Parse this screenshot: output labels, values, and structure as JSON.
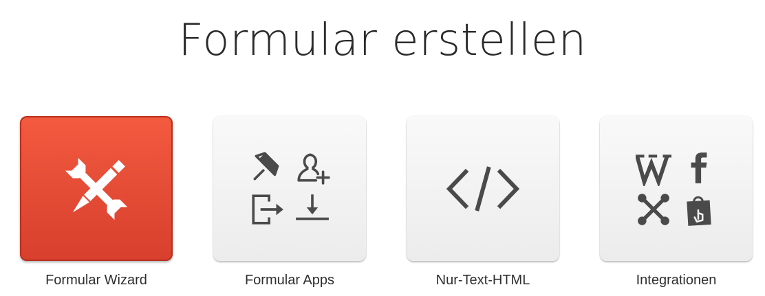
{
  "page": {
    "title": "Formular erstellen"
  },
  "options": [
    {
      "label": "Formular Wizard",
      "icon": "wrench-pencil-icon",
      "active": true
    },
    {
      "label": "Formular Apps",
      "icons": [
        "pushpin-icon",
        "add-user-icon",
        "export-icon",
        "download-icon"
      ]
    },
    {
      "label": "Nur-Text-HTML",
      "icon": "code-icon"
    },
    {
      "label": "Integrationen",
      "icons": [
        "wordpress-icon",
        "facebook-icon",
        "joomla-icon",
        "shopping-bag-icon"
      ]
    }
  ],
  "colors": {
    "active_tile": "#e4472f",
    "tile": "#f1f1f1",
    "icon_gray": "#4a4a4a"
  }
}
